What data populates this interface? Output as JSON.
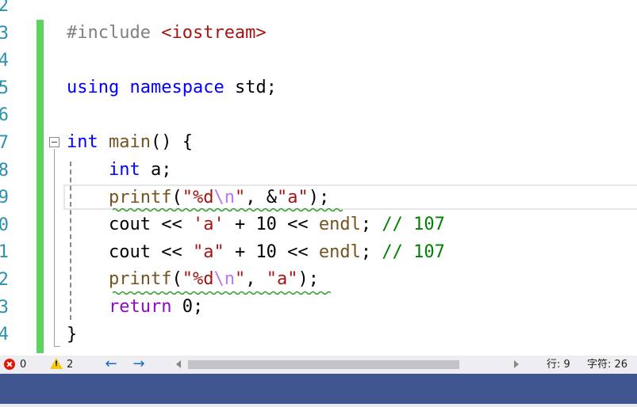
{
  "editor": {
    "line_numbers": [
      "2",
      "3",
      "4",
      "5",
      "6",
      "7",
      "8",
      "9",
      "0",
      "1",
      "2",
      "3",
      "4"
    ],
    "lines": [
      [
        {
          "c": "pp",
          "t": "#include "
        },
        {
          "c": "inc",
          "t": "<iostream>"
        }
      ],
      [],
      [
        {
          "c": "kw",
          "t": "using"
        },
        {
          "c": "",
          "t": " "
        },
        {
          "c": "kw",
          "t": "namespace"
        },
        {
          "c": "",
          "t": " std;"
        }
      ],
      [],
      [
        {
          "c": "kw",
          "t": "int"
        },
        {
          "c": "",
          "t": " "
        },
        {
          "c": "fn",
          "t": "main"
        },
        {
          "c": "",
          "t": "() {"
        }
      ],
      [
        {
          "c": "",
          "t": "    "
        },
        {
          "c": "kw",
          "t": "int"
        },
        {
          "c": "",
          "t": " a;"
        }
      ],
      [
        {
          "c": "",
          "t": "    "
        },
        {
          "c": "fn",
          "t": "printf"
        },
        {
          "c": "",
          "t": "("
        },
        {
          "c": "str",
          "t": "\"%d"
        },
        {
          "c": "esc",
          "t": "\\n"
        },
        {
          "c": "str",
          "t": "\""
        },
        {
          "c": "",
          "t": ", &"
        },
        {
          "c": "str",
          "t": "\"a\""
        },
        {
          "c": "",
          "t": ");"
        }
      ],
      [
        {
          "c": "",
          "t": "    cout << "
        },
        {
          "c": "str",
          "t": "'a'"
        },
        {
          "c": "",
          "t": " + 10 << "
        },
        {
          "c": "fn",
          "t": "endl"
        },
        {
          "c": "",
          "t": "; "
        },
        {
          "c": "cm",
          "t": "// 107"
        }
      ],
      [
        {
          "c": "",
          "t": "    cout << "
        },
        {
          "c": "str",
          "t": "\"a\""
        },
        {
          "c": "",
          "t": " + 10 << "
        },
        {
          "c": "fn",
          "t": "endl"
        },
        {
          "c": "",
          "t": "; "
        },
        {
          "c": "cm",
          "t": "// 107"
        }
      ],
      [
        {
          "c": "",
          "t": "    "
        },
        {
          "c": "fn",
          "t": "printf"
        },
        {
          "c": "",
          "t": "("
        },
        {
          "c": "str",
          "t": "\"%d"
        },
        {
          "c": "esc",
          "t": "\\n"
        },
        {
          "c": "str",
          "t": "\""
        },
        {
          "c": "",
          "t": ", "
        },
        {
          "c": "str",
          "t": "\"a\""
        },
        {
          "c": "",
          "t": ");"
        }
      ],
      [
        {
          "c": "",
          "t": "    "
        },
        {
          "c": "kw2",
          "t": "return"
        },
        {
          "c": "",
          "t": " 0;"
        }
      ],
      [
        {
          "c": "",
          "t": "}"
        }
      ]
    ]
  },
  "status": {
    "errors": "0",
    "warnings": "2",
    "line_label": "行: 9",
    "char_label": "字符: 26"
  },
  "colors": {
    "keyword": "#0000ff",
    "function": "#74531f",
    "string": "#a31515",
    "comment": "#008000",
    "line_number": "#2b91af",
    "change_bar": "#5fd35f",
    "squiggle": "#2e9d2e"
  }
}
